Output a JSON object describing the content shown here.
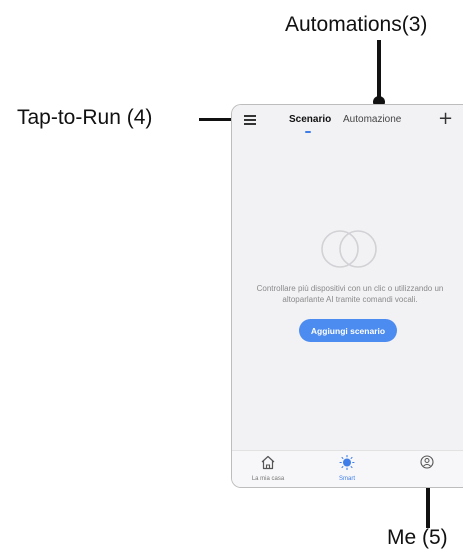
{
  "callouts": {
    "automations": "Automations(3)",
    "tap_to_run": "Tap-to-Run (4)",
    "me": "Me (5)"
  },
  "header": {
    "menu_icon": "hamburger-menu-icon",
    "tabs": [
      {
        "label": "Scenario",
        "active": true
      },
      {
        "label": "Automazione",
        "active": false
      }
    ],
    "add_icon": "plus-icon",
    "add_label": "+"
  },
  "main": {
    "empty_icon": "overlapping-circles-icon",
    "empty_message": "Controllare più dispositivi con un clic o utilizzando un altoparlante AI tramite comandi vocali.",
    "add_button_label": "Aggiungi scenario"
  },
  "bottom_nav": {
    "items": [
      {
        "label": "La mia casa",
        "icon": "home-icon",
        "active": false
      },
      {
        "label": "Smart",
        "icon": "sun-icon",
        "active": true
      },
      {
        "label": "",
        "icon": "user-icon",
        "active": false
      }
    ]
  },
  "colors": {
    "accent": "#3f7ee8",
    "button": "#4c8cf0",
    "background": "#f2f2f5",
    "annotation": "#111111"
  }
}
